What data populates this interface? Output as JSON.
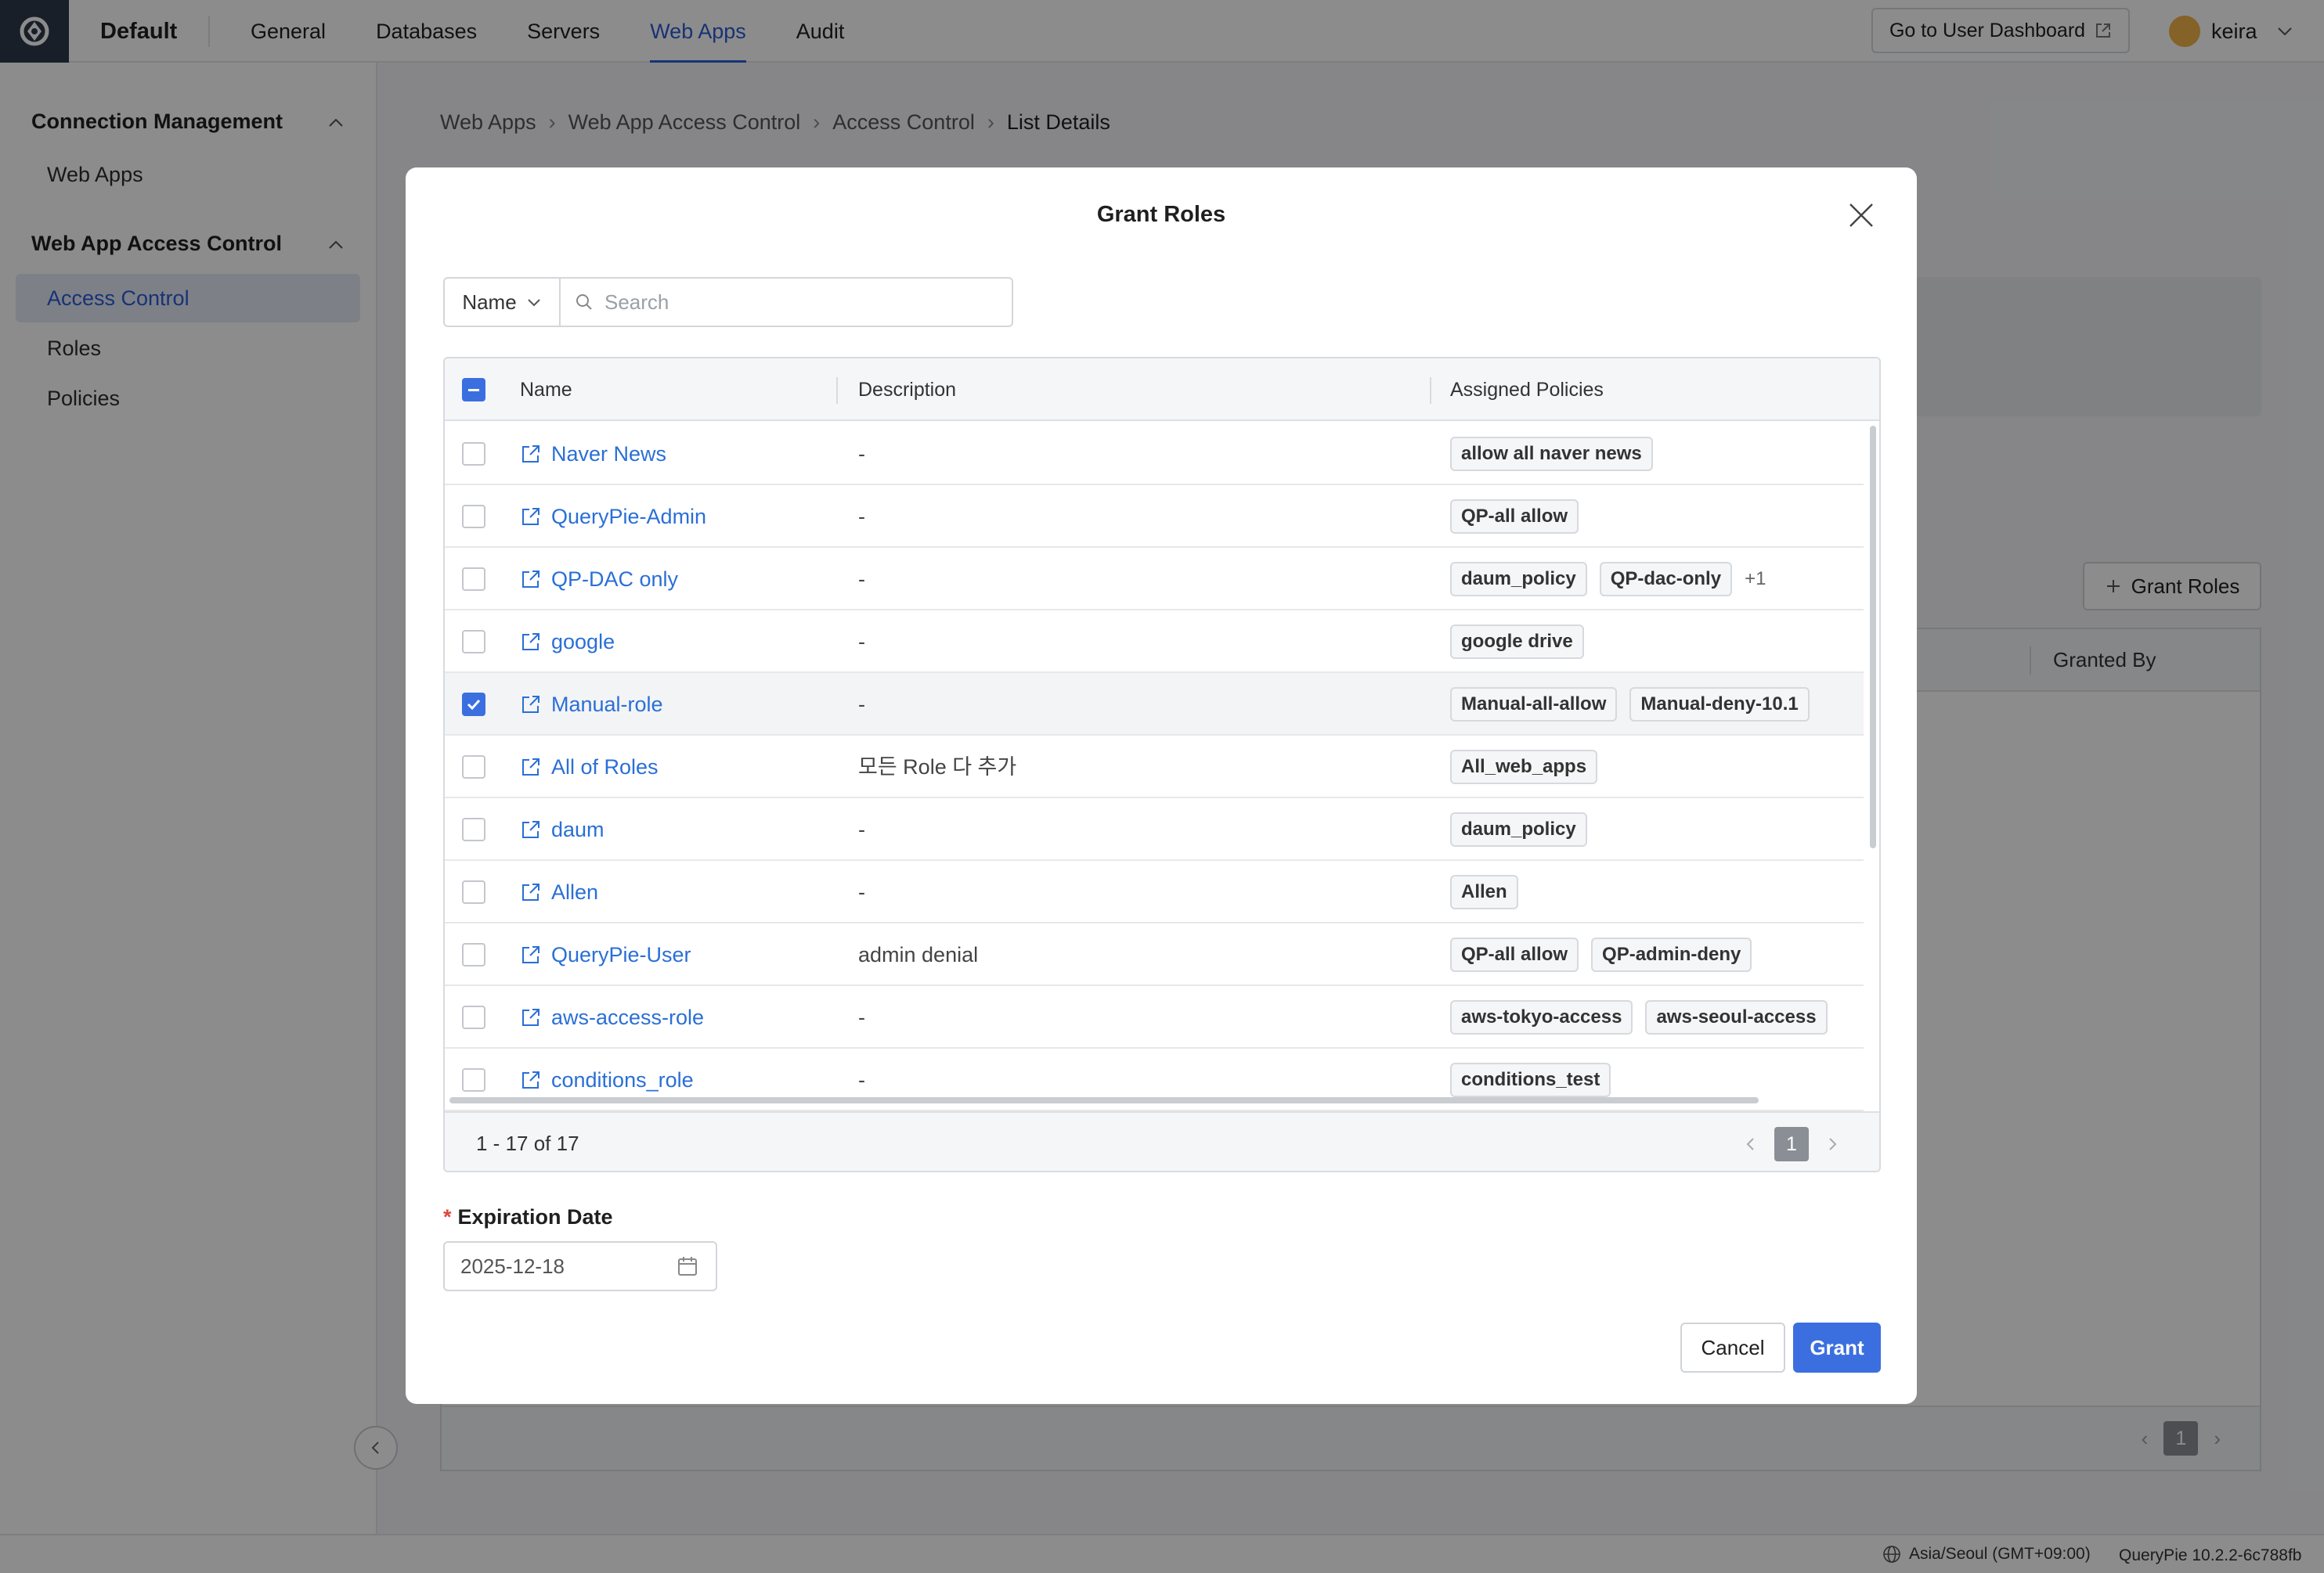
{
  "app": {
    "org_name": "Default",
    "nav": [
      "General",
      "Databases",
      "Servers",
      "Web Apps",
      "Audit"
    ],
    "active_nav": "Web Apps",
    "user_dashboard_label": "Go to User Dashboard",
    "username": "keira"
  },
  "sidebar": {
    "groups": [
      {
        "label": "Connection Management",
        "items": [
          "Web Apps"
        ]
      },
      {
        "label": "Web App Access Control",
        "items": [
          "Access Control",
          "Roles",
          "Policies"
        ]
      }
    ],
    "active_item": "Access Control"
  },
  "breadcrumb": [
    "Web Apps",
    "Web App Access Control",
    "Access Control",
    "List Details"
  ],
  "background": {
    "grant_roles_label": "Grant Roles",
    "column_granted_by": "Granted By",
    "page": "1"
  },
  "modal": {
    "title": "Grant Roles",
    "search_field": "Name",
    "search_placeholder": "Search",
    "columns": [
      "Name",
      "Description",
      "Assigned Policies"
    ],
    "rows": [
      {
        "name": "Naver News",
        "description": "-",
        "policies": [
          "allow all naver news"
        ],
        "more": "",
        "checked": false
      },
      {
        "name": "QueryPie-Admin",
        "description": "-",
        "policies": [
          "QP-all allow"
        ],
        "more": "",
        "checked": false
      },
      {
        "name": "QP-DAC only",
        "description": "-",
        "policies": [
          "daum_policy",
          "QP-dac-only"
        ],
        "more": "+1",
        "checked": false
      },
      {
        "name": "google",
        "description": "-",
        "policies": [
          "google drive"
        ],
        "more": "",
        "checked": false
      },
      {
        "name": "Manual-role",
        "description": "-",
        "policies": [
          "Manual-all-allow",
          "Manual-deny-10.1"
        ],
        "more": "",
        "checked": true
      },
      {
        "name": "All of Roles",
        "description": "모든 Role 다 추가",
        "policies": [
          "All_web_apps"
        ],
        "more": "",
        "checked": false
      },
      {
        "name": "daum",
        "description": "-",
        "policies": [
          "daum_policy"
        ],
        "more": "",
        "checked": false
      },
      {
        "name": "Allen",
        "description": "-",
        "policies": [
          "Allen"
        ],
        "more": "",
        "checked": false
      },
      {
        "name": "QueryPie-User",
        "description": "admin denial",
        "policies": [
          "QP-all allow",
          "QP-admin-deny"
        ],
        "more": "",
        "checked": false
      },
      {
        "name": "aws-access-role",
        "description": "-",
        "policies": [
          "aws-tokyo-access",
          "aws-seoul-access"
        ],
        "more": "",
        "checked": false
      },
      {
        "name": "conditions_role",
        "description": "-",
        "policies": [
          "conditions_test"
        ],
        "more": "",
        "checked": false
      }
    ],
    "range_text": "1 - 17 of 17",
    "page": "1",
    "expiration_label": "Expiration Date",
    "expiration_value": "2025-12-18",
    "cancel_label": "Cancel",
    "grant_label": "Grant"
  },
  "status": {
    "timezone": "Asia/Seoul (GMT+09:00)",
    "version": "QueryPie 10.2.2-6c788fb"
  }
}
